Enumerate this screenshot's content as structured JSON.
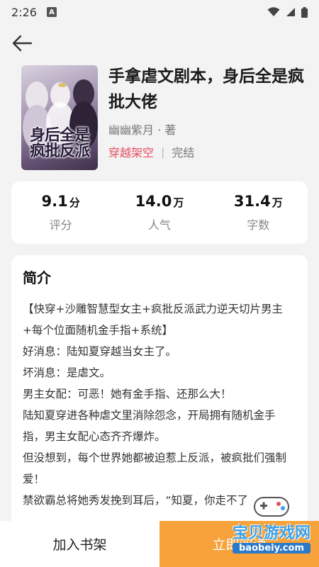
{
  "status_bar": {
    "time": "2:26",
    "badge": "A"
  },
  "book": {
    "title": "手拿虐文剧本，身后全是疯批大佬",
    "cover_title": "身后全是疯批反派",
    "author": "幽幽紫月 · 著",
    "genre": "穿越架空",
    "separator": "|",
    "status": "完结"
  },
  "stats": [
    {
      "value": "9.1",
      "unit": "分",
      "label": "评分"
    },
    {
      "value": "14.0",
      "unit": "万",
      "label": "人气"
    },
    {
      "value": "31.4",
      "unit": "万",
      "label": "字数"
    }
  ],
  "intro": {
    "heading": "简介",
    "lines": [
      "【快穿+沙雕智慧型女主+疯批反派武力逆天切片男主+每个位面随机金手指+系统】",
      "好消息：陆知夏穿越当女主了。",
      "坏消息：是虐文。",
      "男主女配：可恶！她有金手指、还那么大！",
      "陆知夏穿进各种虐文里消除怨念，开局拥有随机金手指，男主女配心态齐齐爆炸。",
      "但没想到，每个世界她都被迫惹上反派，被疯批们强制爱！",
      "禁欲霸总将她秀发挽到耳后，“知夏，你走不了"
    ]
  },
  "bottom": {
    "add_shelf": "加入书架",
    "read_now": "立即阅读"
  },
  "watermark": {
    "text": "宝贝游戏网",
    "url": "baobeiy.com"
  },
  "colors": {
    "accent_pink": "#e84d62",
    "read_button": "#f7a23b",
    "background": "#f3f3f3"
  }
}
